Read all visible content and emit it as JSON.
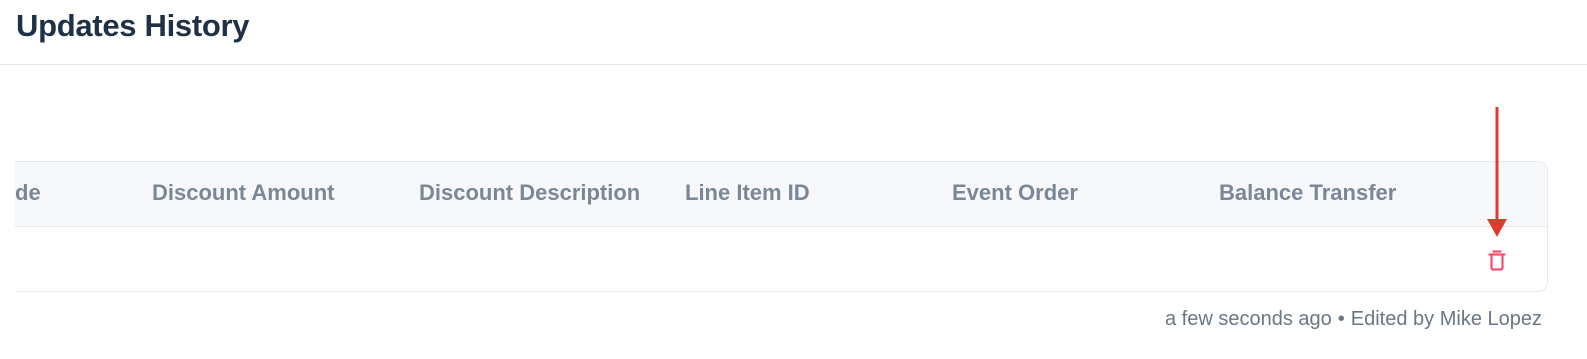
{
  "header": {
    "title": "Updates History"
  },
  "table": {
    "columns": [
      "de",
      "Discount Amount",
      "Discount Description",
      "Line Item ID",
      "Event Order",
      "Balance Transfer"
    ],
    "rows": [
      {
        "delete_icon": "trash-icon"
      }
    ]
  },
  "annotation": {
    "arrow_color": "#e03b2c",
    "icon": "down-arrow-icon"
  },
  "footer": {
    "time": "a few seconds ago",
    "separator": "•",
    "edited_by": "Edited by Mike Lopez"
  },
  "colors": {
    "title": "#1f3147",
    "header_text": "#7b8794",
    "delete": "#f0506e",
    "meta_text": "#6b7785"
  }
}
